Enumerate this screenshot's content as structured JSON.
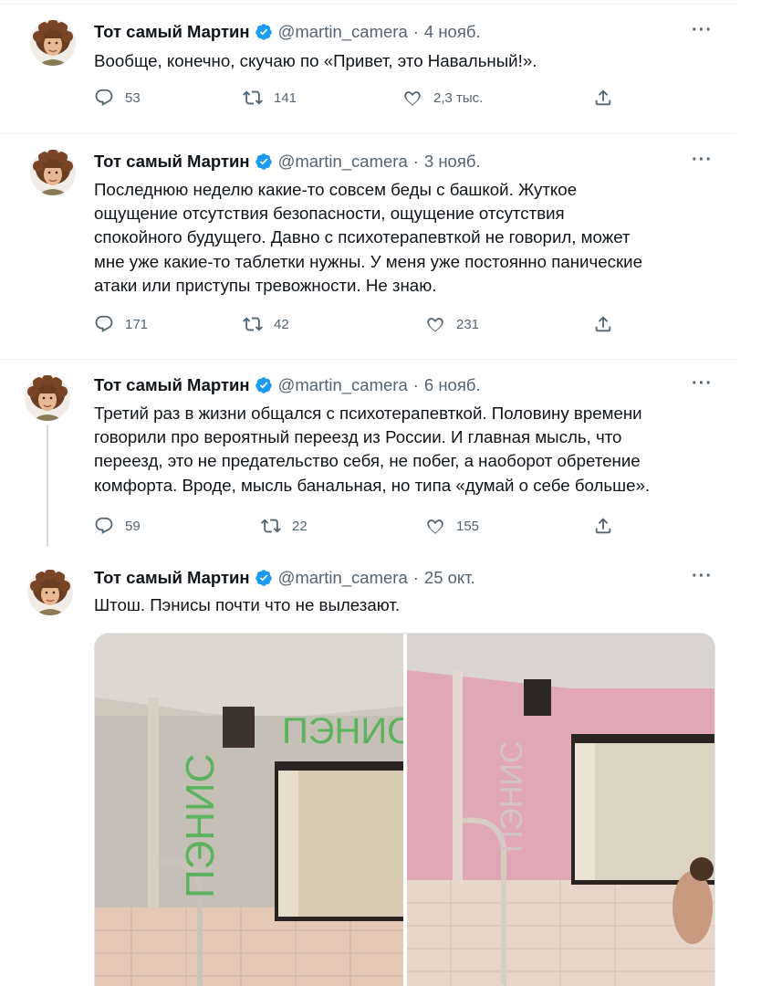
{
  "tweets": [
    {
      "name": "Тот самый Мартин",
      "handle": "@martin_camera",
      "date": "4 нояб.",
      "text": "Вообще, конечно, скучаю по «Привет, это Навальный!».",
      "replies": "53",
      "retweets": "141",
      "likes": "2,3 тыс."
    },
    {
      "name": "Тот самый Мартин",
      "handle": "@martin_camera",
      "date": "3 нояб.",
      "text": "Последнюю неделю какие-то совсем беды с башкой. Жуткое\nощущение отсутствия безопасности, ощущение отсутствия\nспокойного будущего. Давно с психотерапевткой не говорил, может\nмне уже какие-то таблетки нужны. У меня уже постоянно панические\nатаки или приступы тревожности. Не знаю.",
      "replies": "171",
      "retweets": "42",
      "likes": "231"
    },
    {
      "name": "Тот самый Мартин",
      "handle": "@martin_camera",
      "date": "6 нояб.",
      "text": "Третий раз в жизни общался с психотерапевткой. Половину времени\nговорили про вероятный переезд из России. И главная мысль, что\nпереезд, это не предательство себя, не побег, а наоборот обретение\nкомфорта. Вроде, мысль банальная, но типа «думай о себе больше».",
      "replies": "59",
      "retweets": "22",
      "likes": "155"
    },
    {
      "name": "Тот самый Мартин",
      "handle": "@martin_camera",
      "date": "25 окт.",
      "text": "Штош. Пэнисы почти что не вылезают."
    }
  ],
  "ui": {
    "dot": "·",
    "more": "···"
  },
  "media": {
    "left_graffiti": "ПЭНИС",
    "left_graffiti_2": "ПЭНИС",
    "right_graffiti": "ПЭНИС"
  },
  "colors": {
    "verified": "#1d9bf0",
    "secondary_text": "#536471",
    "separator": "#eff3f4"
  }
}
